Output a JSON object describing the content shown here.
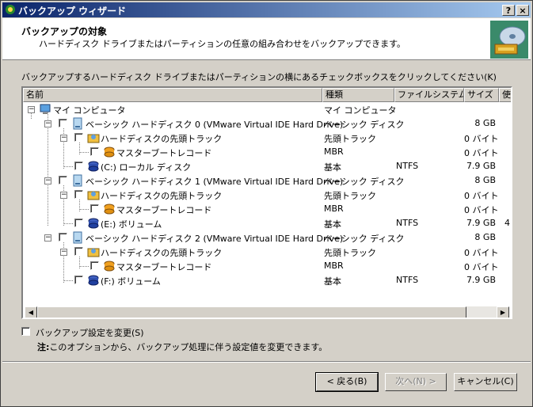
{
  "window": {
    "title": "バックアップ ウィザード",
    "help_button": "?",
    "close_button": "×"
  },
  "header": {
    "title": "バックアップの対象",
    "subtitle": "ハードディスク ドライブまたはパーティションの任意の組み合わせをバックアップできます。",
    "graphic_icon": "backup-wizard-icon"
  },
  "instruction": "バックアップするハードディスク ドライブまたはパーティションの横にあるチェックボックスをクリックしてください(K)",
  "columns": [
    "名前",
    "種類",
    "ファイルシステム",
    "サイズ",
    "使"
  ],
  "rows": [
    {
      "name": "マイ コンピュータ",
      "type": "マイ コンピュータ",
      "fs": "",
      "size": "",
      "extra": "",
      "icon": "computer-icon"
    },
    {
      "name": "ベーシック ハードディスク 0 (VMware Virtual IDE Hard Drive)",
      "type": "ベーシック ディスク",
      "fs": "",
      "size": "8 GB",
      "extra": "",
      "icon": "hard-disk-icon"
    },
    {
      "name": "ハードディスクの先頭トラック",
      "type": "先頭トラック",
      "fs": "",
      "size": "0 バイト",
      "extra": "",
      "icon": "track-icon"
    },
    {
      "name": "マスターブートレコード",
      "type": "MBR",
      "fs": "",
      "size": "0 バイト",
      "extra": "",
      "icon": "mbr-icon"
    },
    {
      "name": "(C:) ローカル ディスク",
      "type": "基本",
      "fs": "NTFS",
      "size": "7.9 GB",
      "extra": "",
      "icon": "partition-icon"
    },
    {
      "name": "ベーシック ハードディスク 1 (VMware Virtual IDE Hard Drive)",
      "type": "ベーシック ディスク",
      "fs": "",
      "size": "8 GB",
      "extra": "",
      "icon": "hard-disk-icon"
    },
    {
      "name": "ハードディスクの先頭トラック",
      "type": "先頭トラック",
      "fs": "",
      "size": "0 バイト",
      "extra": "",
      "icon": "track-icon"
    },
    {
      "name": "マスターブートレコード",
      "type": "MBR",
      "fs": "",
      "size": "0 バイト",
      "extra": "",
      "icon": "mbr-icon"
    },
    {
      "name": "(E:) ボリューム",
      "type": "基本",
      "fs": "NTFS",
      "size": "7.9 GB",
      "extra": "4",
      "icon": "partition-icon"
    },
    {
      "name": "ベーシック ハードディスク 2 (VMware Virtual IDE Hard Drive)",
      "type": "ベーシック ディスク",
      "fs": "",
      "size": "8 GB",
      "extra": "",
      "icon": "hard-disk-icon"
    },
    {
      "name": "ハードディスクの先頭トラック",
      "type": "先頭トラック",
      "fs": "",
      "size": "0 バイト",
      "extra": "",
      "icon": "track-icon"
    },
    {
      "name": "マスターブートレコード",
      "type": "MBR",
      "fs": "",
      "size": "0 バイト",
      "extra": "",
      "icon": "mbr-icon"
    },
    {
      "name": "(F:) ボリューム",
      "type": "基本",
      "fs": "NTFS",
      "size": "7.9 GB",
      "extra": "",
      "icon": "partition-icon"
    }
  ],
  "option": {
    "label": "バックアップ設定を変更(S)",
    "note_bold": "注:",
    "note_text": "このオプションから、バックアップ処理に伴う設定値を変更できます。"
  },
  "buttons": {
    "back": "< 戻る(B)",
    "next": "次へ(N) >",
    "cancel": "キャンセル(C)"
  }
}
